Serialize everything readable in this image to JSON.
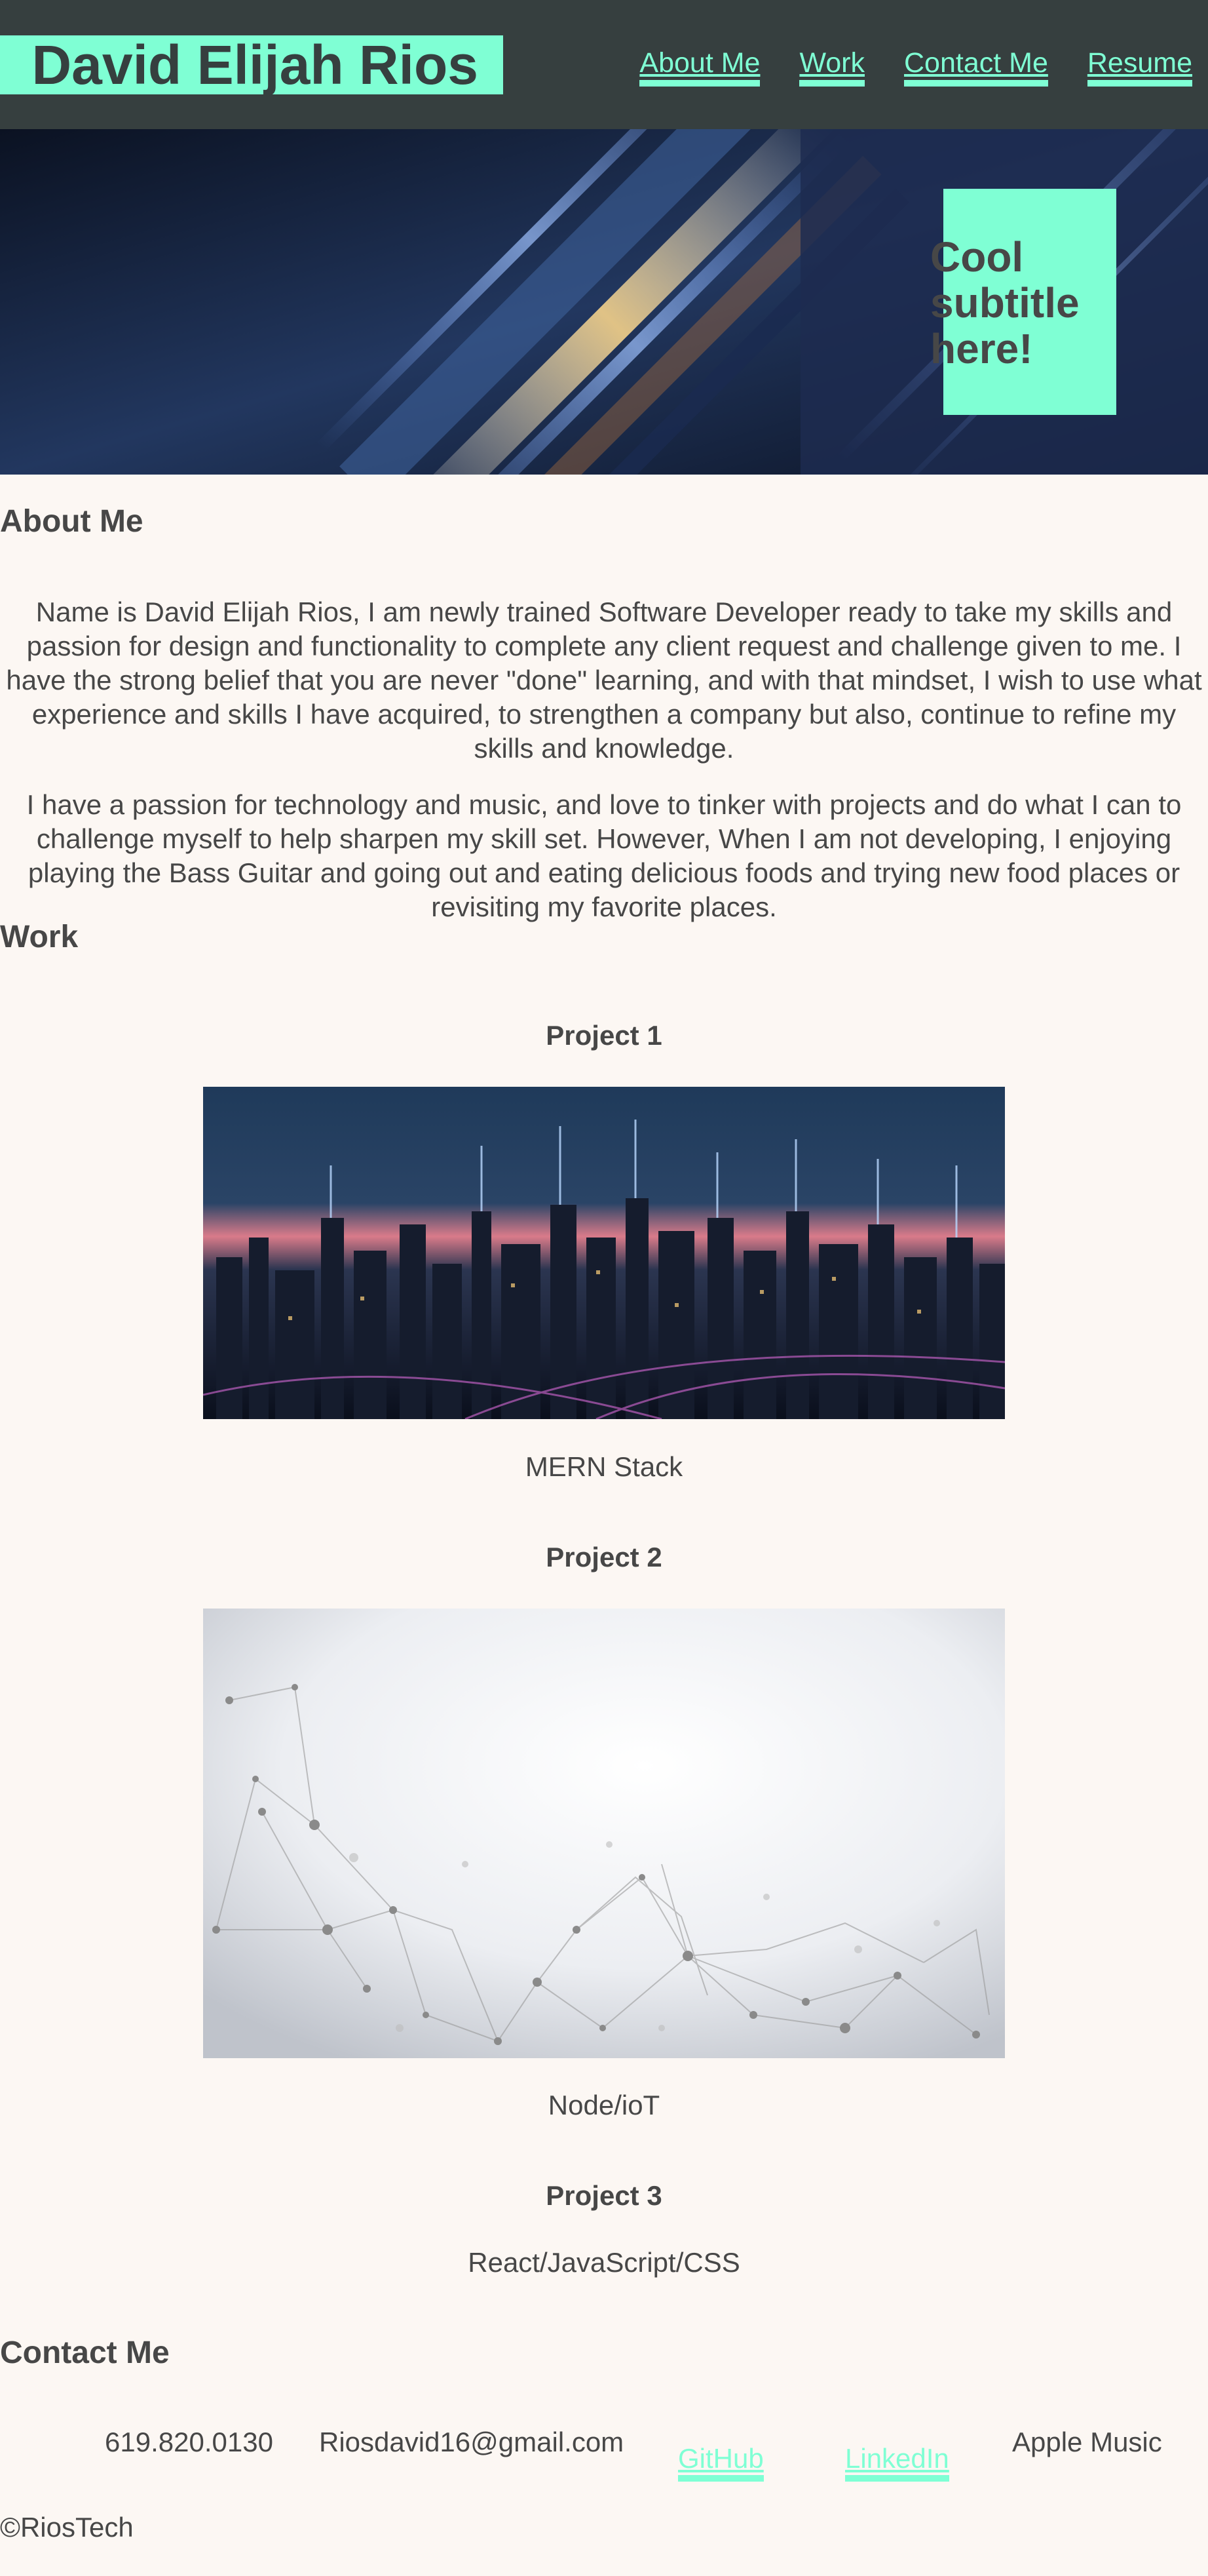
{
  "header": {
    "title": "David Elijah Rios",
    "nav": [
      "About Me",
      "Work",
      "Contact Me",
      "Resume"
    ]
  },
  "hero": {
    "subtitle": "Cool subtitle here!"
  },
  "about": {
    "heading": "About Me",
    "paragraphs": [
      "Name is David Elijah Rios, I am newly trained Software Developer ready to take my skills and passion for design and functionality to complete any client request and challenge given to me. I have the strong belief that you are never \"done\" learning, and with that mindset, I wish to use what experience and skills I have acquired, to strengthen a company but also, continue to refine my skills and knowledge.",
      "I have a passion for technology and music, and love to tinker with projects and do what I can to challenge myself to help sharpen my skill set. However, When I am not developing, I enjoying playing the Bass Guitar and going out and eating delicious foods and trying new food places or revisiting my favorite places."
    ]
  },
  "work": {
    "heading": "Work",
    "projects": [
      {
        "title": "Project 1",
        "tech": "MERN Stack"
      },
      {
        "title": "Project 2",
        "tech": "Node/ioT"
      },
      {
        "title": "Project 3",
        "tech": "React/JavaScript/CSS"
      }
    ]
  },
  "contact": {
    "heading": "Contact Me",
    "phone": "619.820.0130",
    "email": "Riosdavid16@gmail.com",
    "github": "GitHub",
    "linkedin": "LinkedIn",
    "music": "Apple Music"
  },
  "footer": {
    "copyright": "©RiosTech"
  },
  "colors": {
    "accent": "#7fffd4",
    "header_bg": "#363f3f",
    "page_bg": "#fcf7f3",
    "text": "#474747"
  }
}
